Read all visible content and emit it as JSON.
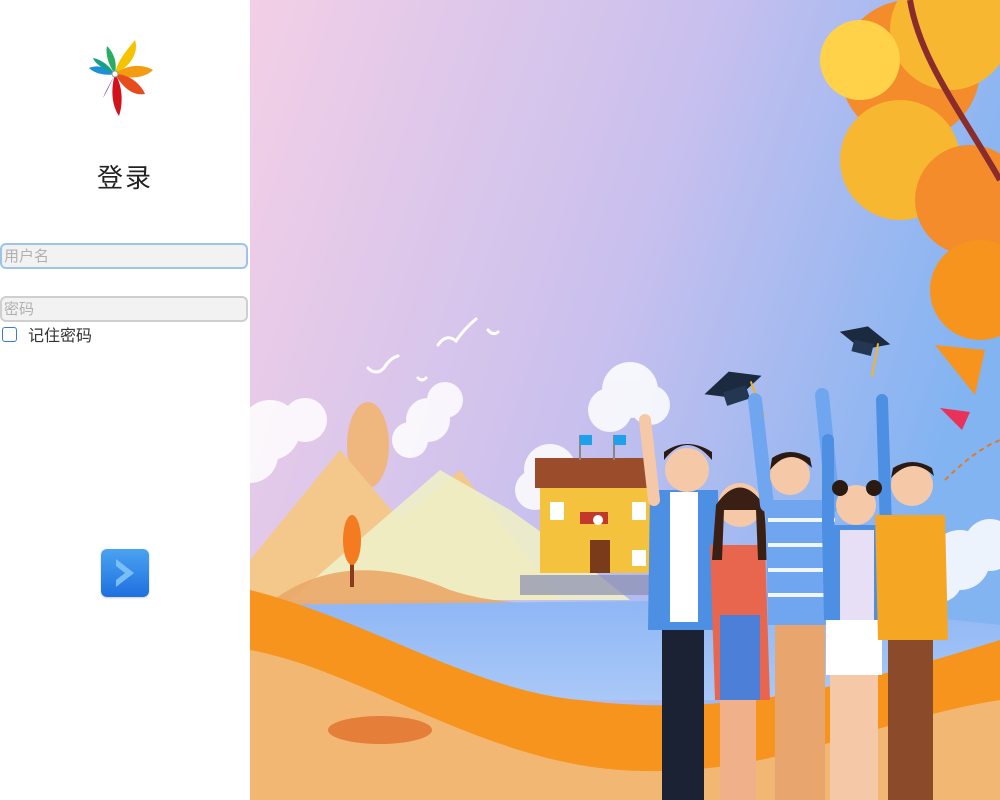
{
  "login": {
    "title": "登录",
    "username_placeholder": "用户名",
    "password_placeholder": "密码",
    "remember_label": "记住密码",
    "remember_checked": false
  },
  "icons": {
    "logo": "flower-logo-icon",
    "submit": "chevron-right-icon"
  },
  "colors": {
    "accent": "#2d7be5",
    "sky_top_left": "#f3cfe6",
    "sky_top_right": "#82b4f2",
    "ground": "#f7941d"
  }
}
